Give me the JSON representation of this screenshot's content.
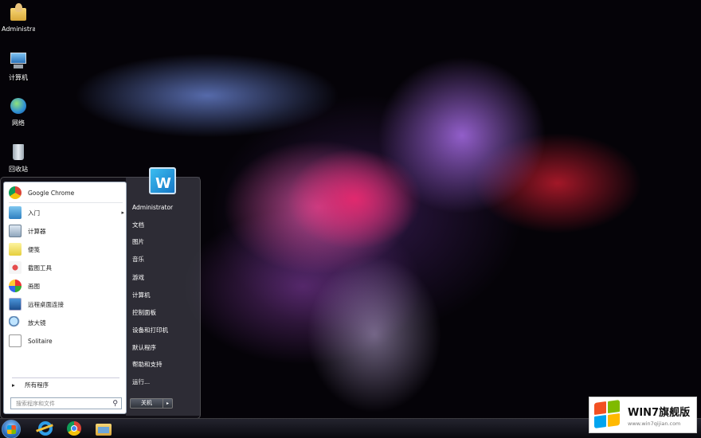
{
  "desktop_icons": [
    {
      "label": "Administra...",
      "icon": "user-folder-icon"
    },
    {
      "label": "计算机",
      "icon": "computer-icon"
    },
    {
      "label": "网络",
      "icon": "network-icon"
    },
    {
      "label": "回收站",
      "icon": "recycle-bin-icon"
    }
  ],
  "start_menu": {
    "programs": [
      {
        "label": "Google Chrome",
        "icon": "chrome-icon",
        "has_submenu": false
      },
      {
        "label": "入门",
        "icon": "getting-started-icon",
        "has_submenu": true
      },
      {
        "label": "计算器",
        "icon": "calculator-icon",
        "has_submenu": false
      },
      {
        "label": "便笺",
        "icon": "sticky-notes-icon",
        "has_submenu": false
      },
      {
        "label": "截图工具",
        "icon": "snipping-tool-icon",
        "has_submenu": false
      },
      {
        "label": "画图",
        "icon": "paint-icon",
        "has_submenu": false
      },
      {
        "label": "远程桌面连接",
        "icon": "remote-desktop-icon",
        "has_submenu": false
      },
      {
        "label": "放大镜",
        "icon": "magnifier-icon",
        "has_submenu": false
      },
      {
        "label": "Solitaire",
        "icon": "solitaire-icon",
        "has_submenu": false
      }
    ],
    "all_programs": "所有程序",
    "search_placeholder": "搜索程序和文件",
    "right_items": [
      "Administrator",
      "文档",
      "图片",
      "音乐",
      "游戏",
      "计算机",
      "控制面板",
      "设备和打印机",
      "默认程序",
      "帮助和支持",
      "运行..."
    ],
    "shutdown_label": "关机",
    "shutdown_arrow": "▸",
    "submenu_arrow": "▸"
  },
  "taskbar": {
    "apps": [
      {
        "name": "internet-explorer-icon"
      },
      {
        "name": "chrome-icon"
      },
      {
        "name": "file-explorer-icon"
      }
    ]
  },
  "watermark": {
    "title": "WIN7旗舰版",
    "url": "www.win7qijian.com"
  }
}
